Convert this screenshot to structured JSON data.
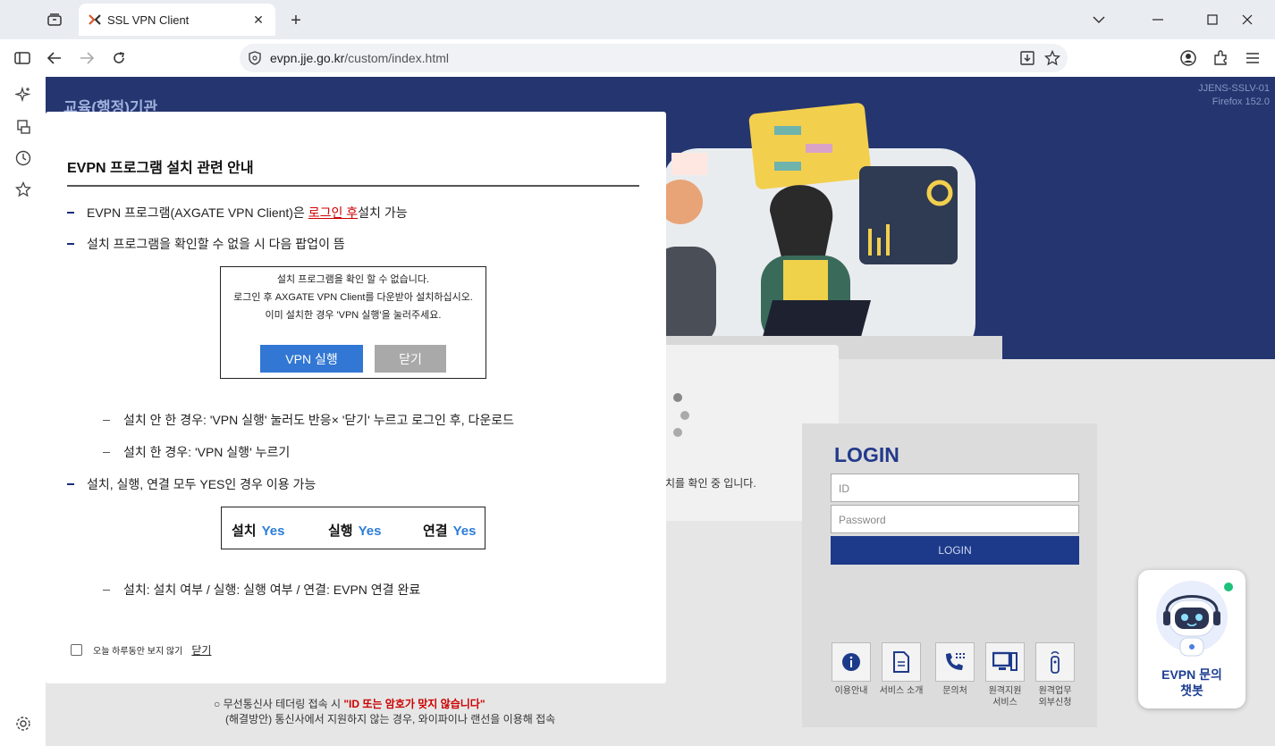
{
  "browser": {
    "tab_title": "SSL VPN Client",
    "url_host": "evpn.jje.go.kr",
    "url_path": "/custom/index.html"
  },
  "hero": {
    "heading": "교육(행정)기관",
    "info_line1": "JJENS-SSLV-01",
    "info_line2": "Firefox 152.0"
  },
  "login": {
    "title": "LOGIN",
    "id_placeholder": "ID",
    "pw_placeholder": "Password",
    "button": "LOGIN"
  },
  "loading": {
    "text": "치를 확인 중 입니다."
  },
  "services": [
    {
      "label": "이용안내"
    },
    {
      "label": "서비스 소개"
    },
    {
      "label": "문의처"
    },
    {
      "label": "원격지원\n서비스"
    },
    {
      "label": "원격업무\n외부신청"
    }
  ],
  "notice": {
    "prefix": "○ 무선통신사 테더링 접속 시 ",
    "highlight": "\"ID 또는 암호가 맞지 않습니다\"",
    "line2": "(해결방안) 통신사에서 지원하지 않는 경우, 와이파이나 랜선을 이용해 접속"
  },
  "modal": {
    "title": "EVPN 프로그램 설치 관련 안내",
    "b1_pre": "EVPN 프로그램(AXGATE VPN Client)은 ",
    "b1_link": "로그인 후",
    "b1_post": "설치 가능",
    "b2": "설치 프로그램을 확인할 수 없을 시 다음 팝업이 뜸",
    "popup_line1": "설치 프로그램을 확인 할 수 없습니다.",
    "popup_line2": "로그인 후 AXGATE VPN Client를 다운받아 설치하십시오.",
    "popup_line3": "이미 설치한 경우 'VPN 실행'을 눌러주세요.",
    "popup_run": "VPN 실행",
    "popup_close": "닫기",
    "sub1": "설치 안 한 경우: 'VPN 실행' 눌러도 반응× '닫기' 누르고 로그인 후, 다운로드",
    "sub2": "설치 한 경우: 'VPN 실행' 누르기",
    "b3": "설치, 실행, 연결 모두 YES인 경우 이용 가능",
    "status": [
      {
        "label": "설치",
        "value": "Yes"
      },
      {
        "label": "실행",
        "value": "Yes"
      },
      {
        "label": "연결",
        "value": "Yes"
      }
    ],
    "sub3": "설치: 설치 여부 / 실행: 실행 여부 / 연결: EVPN 연결 완료",
    "dont_show": "오늘 하루동안 보지 않기",
    "close": "닫기"
  },
  "chatbot": {
    "line1": "EVPN 문의",
    "line2": "챗봇"
  },
  "colors": {
    "hero_bg": "#24356f",
    "accent_blue": "#3277d3",
    "yes_blue": "#2c7dd6",
    "link_red": "#cc0000",
    "chat_online": "#1cc17a"
  }
}
